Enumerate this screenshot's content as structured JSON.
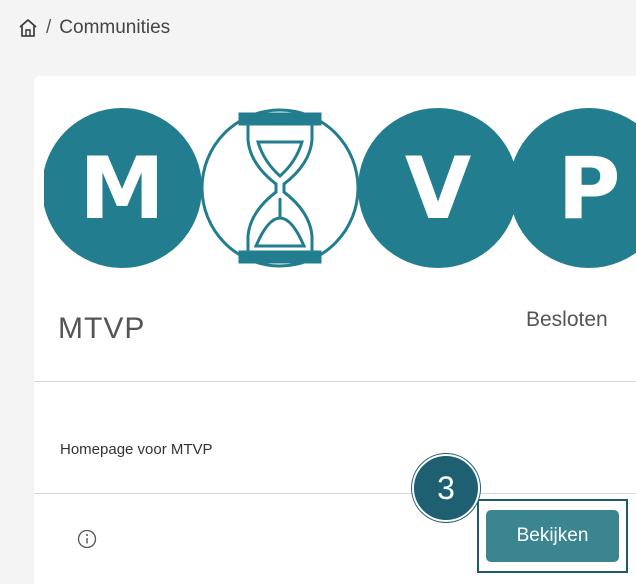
{
  "breadcrumb": {
    "home_icon": "home-icon",
    "separator": "/",
    "current": "Communities"
  },
  "community": {
    "logo": {
      "letters": [
        "M",
        "V",
        "P"
      ],
      "hourglass_icon": "hourglass-icon",
      "accent_color": "#227d8e"
    },
    "title": "MTVP",
    "status": "Besloten",
    "description": "Homepage voor MTVP",
    "info_icon": "info-icon",
    "view_button_label": "Bekijken",
    "button_color": "#3a8590"
  },
  "annotation": {
    "step_number": "3",
    "badge_color": "#1e5f72"
  }
}
